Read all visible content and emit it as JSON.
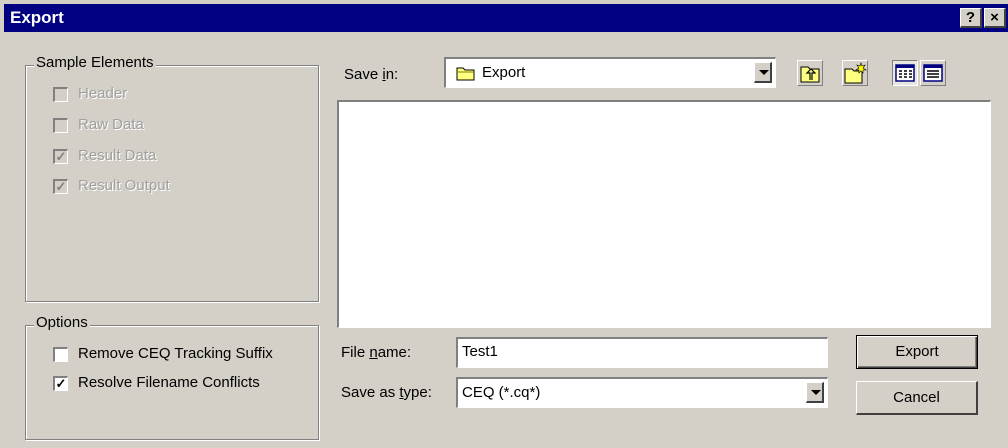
{
  "window": {
    "title": "Export",
    "help_label": "?",
    "close_label": "×"
  },
  "sample_elements": {
    "legend": "Sample Elements",
    "items": [
      {
        "label": "Header",
        "checked": false
      },
      {
        "label": "Raw Data",
        "checked": false
      },
      {
        "label": "Result Data",
        "checked": true
      },
      {
        "label": "Result Output",
        "checked": true
      }
    ]
  },
  "options": {
    "legend": "Options",
    "items": [
      {
        "label": "Remove CEQ Tracking Suffix",
        "checked": false
      },
      {
        "label": "Resolve Filename Conflicts",
        "checked": true
      }
    ]
  },
  "save_in": {
    "label_pre": "Save ",
    "label_mn": "i",
    "label_post": "n:",
    "value": "Export"
  },
  "file_name": {
    "label_pre": "File ",
    "label_mn": "n",
    "label_post": "ame:",
    "value": "Test1"
  },
  "save_as_type": {
    "label_pre": "Save as ",
    "label_mn": "t",
    "label_post": "ype:",
    "value": "CEQ (*.cq*)"
  },
  "buttons": {
    "export": "Export",
    "cancel": "Cancel"
  },
  "check_mark": "✓"
}
